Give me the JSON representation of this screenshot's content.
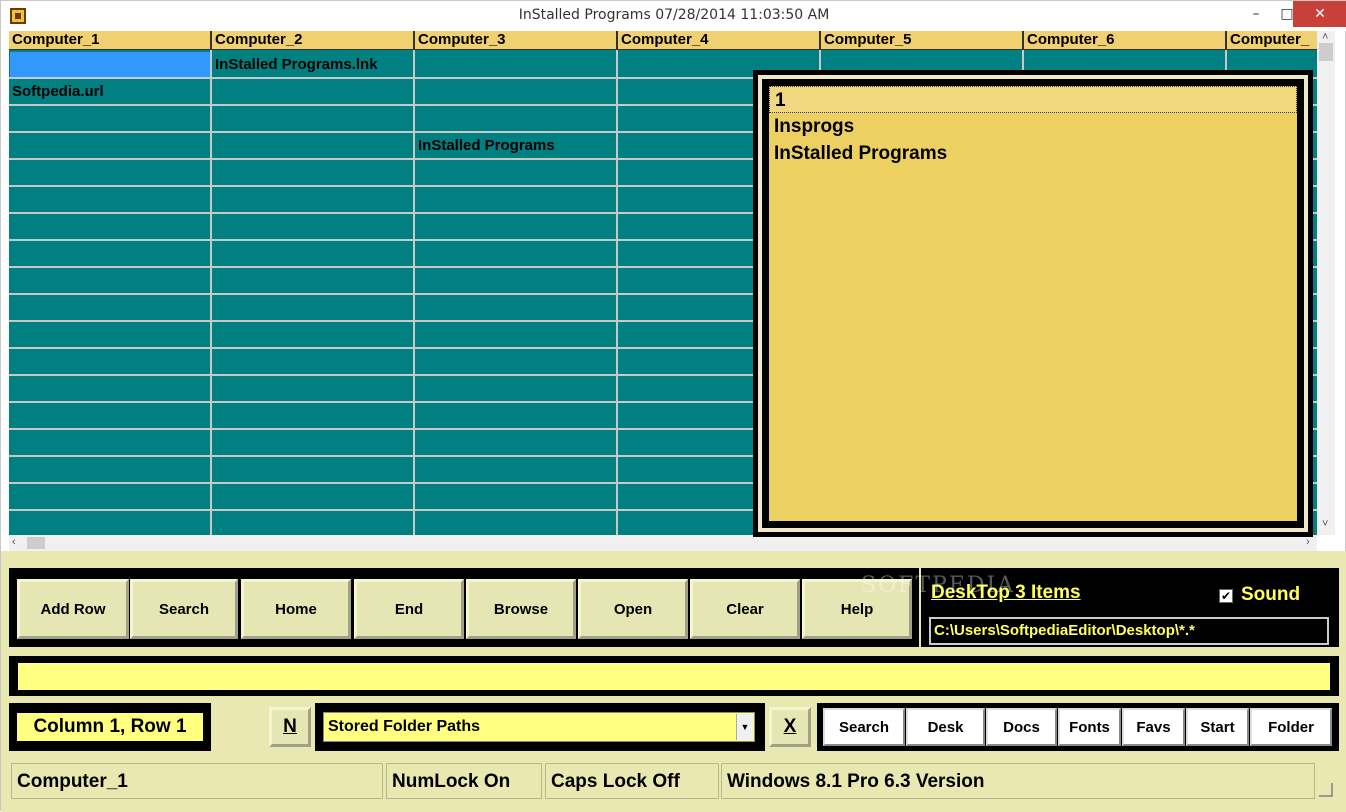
{
  "window": {
    "title": "InStalled Programs 07/28/2014  11:03:50 AM",
    "min": "–",
    "max": "□",
    "close": "✕"
  },
  "grid": {
    "headers": [
      "Computer_1",
      "Computer_2",
      "Computer_3",
      "Computer_4",
      "Computer_5",
      "Computer_6",
      "Computer_"
    ],
    "cells": [
      {
        "row": 0,
        "col": 1,
        "text": "InStalled Programs.lnk"
      },
      {
        "row": 1,
        "col": 0,
        "text": "Softpedia.url"
      },
      {
        "row": 3,
        "col": 2,
        "text": "InStalled Programs"
      }
    ]
  },
  "popup": {
    "items": [
      "1",
      "Insprogs",
      "InStalled Programs"
    ]
  },
  "buttons": [
    "Add Row",
    "Search",
    "Home",
    "End",
    "Browse",
    "Open",
    "Clear",
    "Help"
  ],
  "desk": {
    "link": "DeskTop 3 Items",
    "sound_label": "Sound",
    "sound_checked": true,
    "path": "C:\\Users\\SoftpediaEditor\\Desktop\\*.*"
  },
  "message": "",
  "position": "Column 1, Row 1",
  "n_button": "N",
  "folder_select": {
    "value": "Stored Folder Paths"
  },
  "x_button": "X",
  "quick_buttons": [
    "Search",
    "Desk",
    "Docs",
    "Fonts",
    "Favs",
    "Start",
    "Folder"
  ],
  "status": {
    "cell": "Computer_1",
    "numlock": "NumLock On",
    "capslock": "Caps Lock Off",
    "os": "Windows 8.1 Pro 6.3 Version"
  },
  "watermark": "SOFTPEDIA",
  "colors": {
    "grid": "#008080",
    "header": "#f0d070",
    "popup": "#edd062",
    "panel": "#e8e8b0",
    "highlight": "#ffff80",
    "accent": "#ffff60"
  }
}
